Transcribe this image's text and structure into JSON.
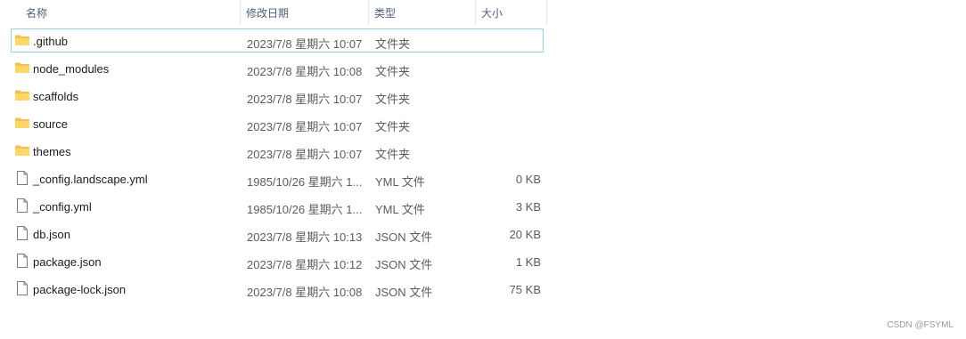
{
  "header": {
    "name": "名称",
    "date": "修改日期",
    "type": "类型",
    "size": "大小",
    "sort_icon": "chevron-up-icon"
  },
  "files": [
    {
      "name": ".github",
      "date": "2023/7/8 星期六 10:07",
      "type": "文件夹",
      "size": "",
      "icon": "folder-icon",
      "selected": true
    },
    {
      "name": "node_modules",
      "date": "2023/7/8 星期六 10:08",
      "type": "文件夹",
      "size": "",
      "icon": "folder-icon"
    },
    {
      "name": "scaffolds",
      "date": "2023/7/8 星期六 10:07",
      "type": "文件夹",
      "size": "",
      "icon": "folder-icon"
    },
    {
      "name": "source",
      "date": "2023/7/8 星期六 10:07",
      "type": "文件夹",
      "size": "",
      "icon": "folder-icon"
    },
    {
      "name": "themes",
      "date": "2023/7/8 星期六 10:07",
      "type": "文件夹",
      "size": "",
      "icon": "folder-icon"
    },
    {
      "name": "_config.landscape.yml",
      "date": "1985/10/26 星期六 1...",
      "type": "YML 文件",
      "size": "0 KB",
      "icon": "file-icon"
    },
    {
      "name": "_config.yml",
      "date": "1985/10/26 星期六 1...",
      "type": "YML 文件",
      "size": "3 KB",
      "icon": "file-icon"
    },
    {
      "name": "db.json",
      "date": "2023/7/8 星期六 10:13",
      "type": "JSON 文件",
      "size": "20 KB",
      "icon": "file-icon"
    },
    {
      "name": "package.json",
      "date": "2023/7/8 星期六 10:12",
      "type": "JSON 文件",
      "size": "1 KB",
      "icon": "file-icon"
    },
    {
      "name": "package-lock.json",
      "date": "2023/7/8 星期六 10:08",
      "type": "JSON 文件",
      "size": "75 KB",
      "icon": "file-icon"
    }
  ],
  "watermark": "CSDN @FSYML"
}
